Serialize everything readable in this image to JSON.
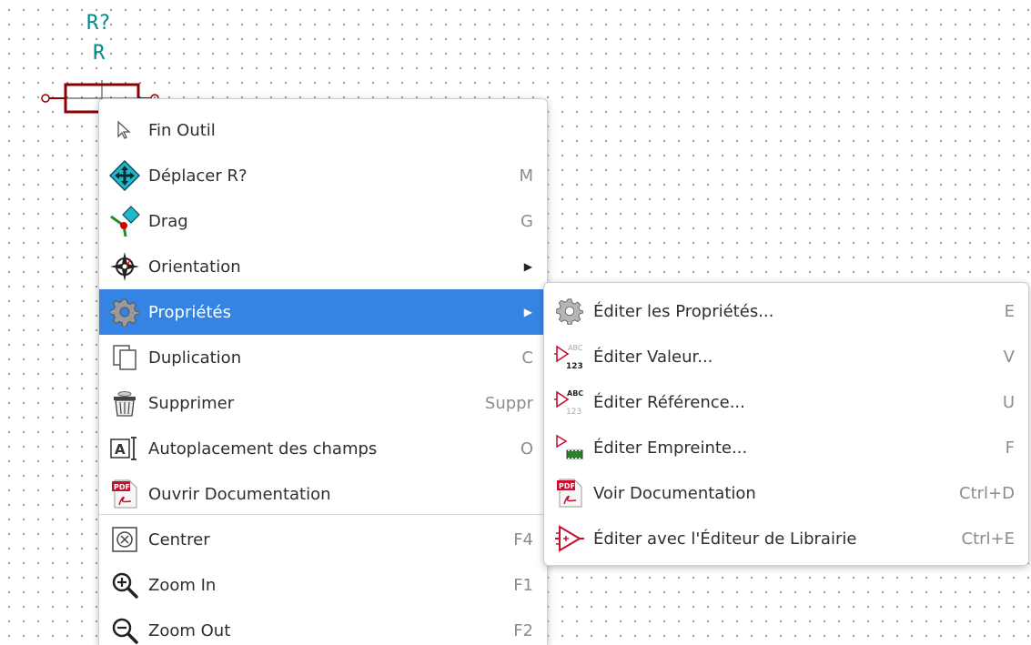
{
  "canvas": {
    "reference": "R?",
    "value": "R"
  },
  "context_menu": {
    "items": [
      {
        "label": "Fin Outil",
        "shortcut": "",
        "icon": "cursor-arrow-icon"
      },
      {
        "label": "Déplacer R?",
        "shortcut": "M",
        "icon": "move-icon"
      },
      {
        "label": "Drag",
        "shortcut": "G",
        "icon": "drag-icon"
      },
      {
        "label": "Orientation",
        "shortcut": "",
        "icon": "orientation-icon"
      },
      {
        "label": "Propriétés",
        "shortcut": "",
        "icon": "gear-icon"
      },
      {
        "label": "Duplication",
        "shortcut": "C",
        "icon": "duplicate-icon"
      },
      {
        "label": "Supprimer",
        "shortcut": "Suppr",
        "icon": "trash-icon"
      },
      {
        "label": "Autoplacement des champs",
        "shortcut": "O",
        "icon": "autoplace-fields-icon"
      },
      {
        "label": "Ouvrir Documentation",
        "shortcut": "",
        "icon": "pdf-icon"
      },
      {
        "label": "Centrer",
        "shortcut": "F4",
        "icon": "center-icon"
      },
      {
        "label": "Zoom In",
        "shortcut": "F1",
        "icon": "zoom-in-icon"
      },
      {
        "label": "Zoom Out",
        "shortcut": "F2",
        "icon": "zoom-out-icon"
      }
    ]
  },
  "submenu": {
    "items": [
      {
        "label": "Éditer les Propriétés...",
        "shortcut": "E",
        "icon": "gear-icon"
      },
      {
        "label": "Éditer Valeur...",
        "shortcut": "V",
        "icon": "edit-value-icon"
      },
      {
        "label": "Éditer Référence...",
        "shortcut": "U",
        "icon": "edit-reference-icon"
      },
      {
        "label": "Éditer Empreinte...",
        "shortcut": "F",
        "icon": "edit-footprint-icon"
      },
      {
        "label": "Voir Documentation",
        "shortcut": "Ctrl+D",
        "icon": "pdf-icon"
      },
      {
        "label": "Éditer avec l'Éditeur de Librairie",
        "shortcut": "Ctrl+E",
        "icon": "library-editor-icon"
      }
    ]
  },
  "colors": {
    "highlight": "#3584e4",
    "component_text": "#008b8b",
    "component_body": "#8b0000"
  }
}
